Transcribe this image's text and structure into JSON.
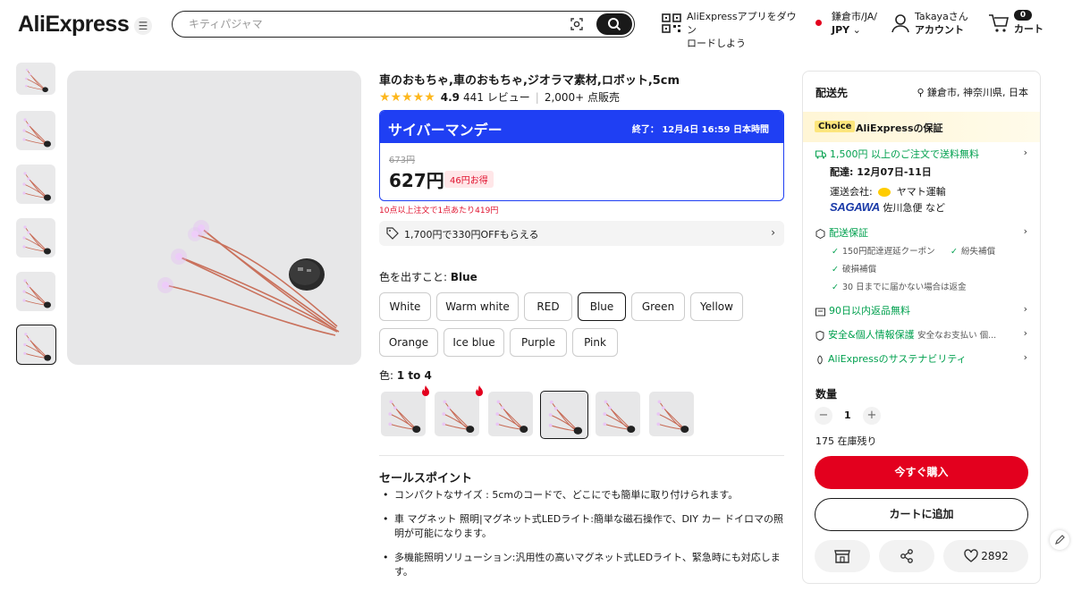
{
  "header": {
    "logo": "AliExpress",
    "search_placeholder": "キティパジャマ",
    "app_line1": "AliExpressアプリをダウン",
    "app_line2": "ロードしよう",
    "region_line1": "鎌倉市/JA/",
    "region_line2": "JPY",
    "user_line1": "Takayaさん",
    "user_line2": "アカウント",
    "cart_count": "0",
    "cart_label": "カート"
  },
  "product": {
    "title": "車のおもちゃ,車のおもちゃ,ジオラマ素材,ロボット,5cm",
    "rating": "4.9",
    "reviews": "441 レビュー",
    "sold": "2,000+ 点販売",
    "stars": 5
  },
  "sale": {
    "name": "サイバーマンデー",
    "end_label": "終了：",
    "end_time": "12月4日 16:59 日本時間",
    "old_price": "673円",
    "price": "627円",
    "discount": "46円お得",
    "bulk": "10点以上注文で1点あたり419円"
  },
  "coupon": {
    "text": "1,700円で330円OFFもらえる"
  },
  "color_option": {
    "label": "色を出すこと: ",
    "selected": "Blue",
    "options": [
      "White",
      "Warm white",
      "RED",
      "Blue",
      "Green",
      "Yellow",
      "Orange",
      "Ice blue",
      "Purple",
      "Pink"
    ]
  },
  "variant": {
    "label": "色: ",
    "selected": "1 to 4"
  },
  "selling_points": {
    "title": "セールスポイント",
    "items": [
      "コンパクトなサイズ : 5cmのコードで、どこにでも簡単に取り付けられます。",
      "車 マグネット 照明|マグネット式LEDライト:簡単な磁石操作で、DIY カー ドイロマの照明が可能になります。",
      "多機能照明ソリューション:汎用性の高いマグネット式LEDライト、緊急時にも対応します。"
    ]
  },
  "panel": {
    "ship_to": "配送先",
    "location": "鎌倉市, 神奈川県, 日本",
    "choice_badge": "Choice",
    "choice_text": "AliExpressの保証",
    "free_ship": "1,500円 以上のご注文で送料無料",
    "delivery": "配達: 12月07日-11日",
    "carrier_label": "運送会社:",
    "carrier1": "ヤマト運輸",
    "carrier2_logo": "SAGAWA",
    "carrier2": "佐川急便 など",
    "guarantee": "配送保証",
    "g1": "150円配達遅延クーポン",
    "g2": "紛失補償",
    "g3": "破損補償",
    "g4": "30 日までに届かない場合は返金",
    "returns": "90日以内返品無料",
    "security": "安全&個人情報保護",
    "security_sub": "安全なお支払い 個...",
    "sustain": "AliExpressのサステナビリティ",
    "qty_label": "数量",
    "qty": "1",
    "stock": "175 在庫残り",
    "buy": "今すぐ購入",
    "add_cart": "カートに追加",
    "wishlist_count": "2892"
  },
  "colors": {
    "brand_red": "#e3001e",
    "sale_blue": "#1f3ff3",
    "green": "#00a04e",
    "star": "#fdb71d"
  }
}
